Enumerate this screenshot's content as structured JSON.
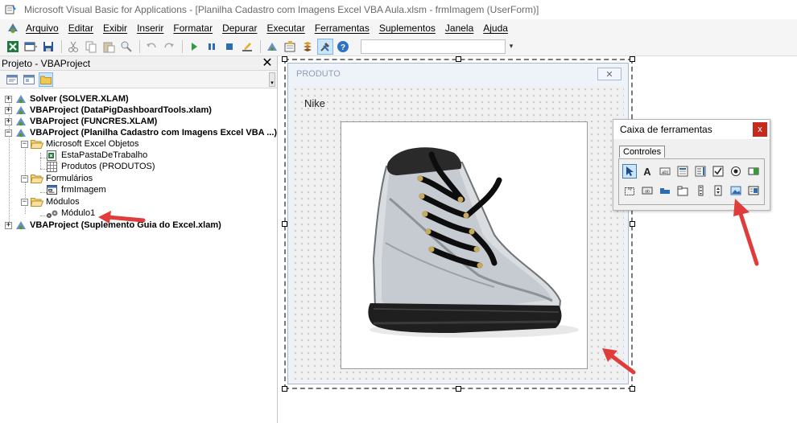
{
  "window": {
    "title": "Microsoft Visual Basic for Applications - [Planilha Cadastro com Imagens Excel VBA Aula.xlsm - frmImagem (UserForm)]"
  },
  "menu": {
    "items": [
      "Arquivo",
      "Editar",
      "Exibir",
      "Inserir",
      "Formatar",
      "Depurar",
      "Executar",
      "Ferramentas",
      "Suplementos",
      "Janela",
      "Ajuda"
    ]
  },
  "project_pane": {
    "title": "Projeto - VBAProject",
    "close_glyph": "✕",
    "tree": {
      "solver": "Solver (SOLVER.XLAM)",
      "datapig": "VBAProject (DataPigDashboardTools.xlam)",
      "funcres": "VBAProject (FUNCRES.XLAM)",
      "planilha": "VBAProject (Planilha Cadastro com Imagens Excel VBA ...)",
      "excel_objects": "Microsoft Excel Objetos",
      "esta_pasta": "EstaPastaDeTrabalho",
      "produtos": "Produtos (PRODUTOS)",
      "formularios": "Formulários",
      "frm_imagem": "frmImagem",
      "modulos": "Módulos",
      "modulo1": "Módulo1",
      "guia": "VBAProject (Suplemento Guia do Excel.xlam)"
    }
  },
  "userform": {
    "caption": "PRODUTO",
    "close_glyph": "✕",
    "label": "Nike",
    "image_description": "transparent boot with black laces"
  },
  "toolbox": {
    "title": "Caixa de ferramentas",
    "close_glyph": "x",
    "tab": "Controles"
  },
  "colors": {
    "arrow": "#e03c3c",
    "toolbox_close": "#c42b1c",
    "selection": "#cde6f7"
  }
}
